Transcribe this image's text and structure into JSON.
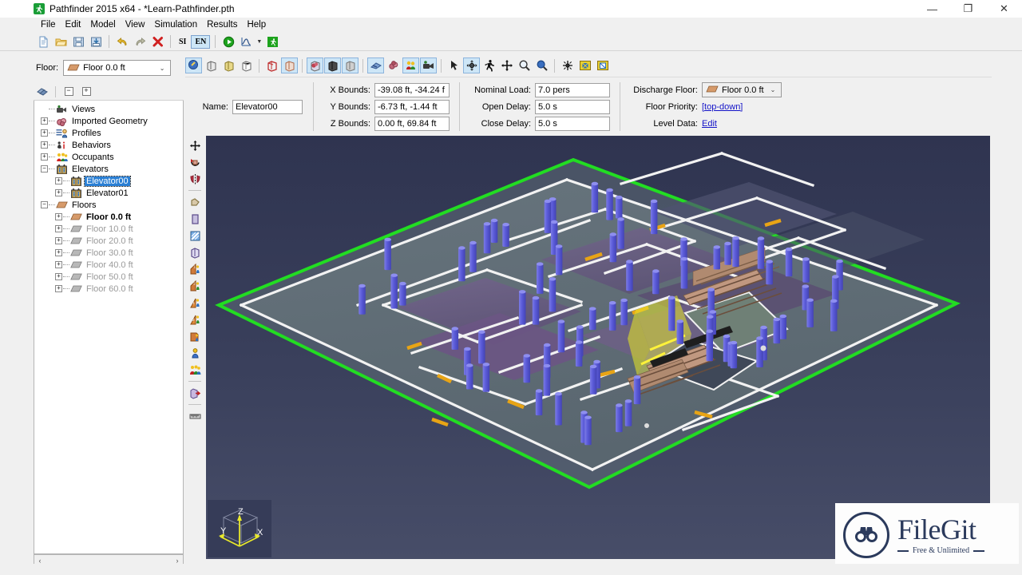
{
  "window": {
    "title": "Pathfinder 2015 x64 - *Learn-Pathfinder.pth",
    "app_icon": "runner-icon",
    "minimize": "—",
    "restore": "❐",
    "close": "✕"
  },
  "menu": {
    "items": [
      {
        "label": "File"
      },
      {
        "label": "Edit"
      },
      {
        "label": "Model"
      },
      {
        "label": "View"
      },
      {
        "label": "Simulation"
      },
      {
        "label": "Results"
      },
      {
        "label": "Help"
      }
    ]
  },
  "toolbar": {
    "items": [
      {
        "name": "new-file-icon",
        "kind": "icon"
      },
      {
        "name": "open-folder-icon",
        "kind": "icon"
      },
      {
        "name": "save-icon",
        "kind": "icon"
      },
      {
        "name": "import-icon",
        "kind": "icon"
      },
      {
        "name": "separator",
        "kind": "sep"
      },
      {
        "name": "undo-icon",
        "kind": "icon"
      },
      {
        "name": "redo-icon",
        "kind": "icon"
      },
      {
        "name": "delete-icon",
        "kind": "icon"
      },
      {
        "name": "separator",
        "kind": "sep"
      },
      {
        "name": "si-units-button",
        "kind": "text",
        "label": "SI",
        "selected": false
      },
      {
        "name": "english-units-button",
        "kind": "text",
        "label": "EN",
        "selected": true
      },
      {
        "name": "separator",
        "kind": "sep"
      },
      {
        "name": "run-simulation-icon",
        "kind": "icon"
      },
      {
        "name": "results-plot-icon",
        "kind": "icon"
      },
      {
        "name": "dropdown-caret-icon",
        "kind": "caret"
      },
      {
        "name": "results-3d-icon",
        "kind": "icon"
      }
    ]
  },
  "floor_selector": {
    "label": "Floor:",
    "value": "Floor 0.0 ft",
    "icon": "floor-icon"
  },
  "tree_toolbar": {
    "navigator_icon": "navigator-icon",
    "collapse_all": "−",
    "expand_all": "+"
  },
  "tree": {
    "nodes": [
      {
        "label": "Views",
        "indent": 0,
        "expander": "none",
        "icon": "views-icon",
        "style": "normal"
      },
      {
        "label": "Imported Geometry",
        "indent": 0,
        "expander": "+",
        "icon": "geometry-icon",
        "style": "normal"
      },
      {
        "label": "Profiles",
        "indent": 0,
        "expander": "+",
        "icon": "profiles-icon",
        "style": "normal"
      },
      {
        "label": "Behaviors",
        "indent": 0,
        "expander": "+",
        "icon": "behaviors-icon",
        "style": "normal"
      },
      {
        "label": "Occupants",
        "indent": 0,
        "expander": "+",
        "icon": "occupants-icon",
        "style": "normal"
      },
      {
        "label": "Elevators",
        "indent": 0,
        "expander": "−",
        "icon": "elevator-icon",
        "style": "normal"
      },
      {
        "label": "Elevator00",
        "indent": 1,
        "expander": "+",
        "icon": "elevator-icon",
        "style": "selected"
      },
      {
        "label": "Elevator01",
        "indent": 1,
        "expander": "+",
        "icon": "elevator-icon",
        "style": "normal"
      },
      {
        "label": "Floors",
        "indent": 0,
        "expander": "−",
        "icon": "floor-icon",
        "style": "normal"
      },
      {
        "label": "Floor 0.0 ft",
        "indent": 1,
        "expander": "+",
        "icon": "floor-icon",
        "style": "bold"
      },
      {
        "label": "Floor 10.0 ft",
        "indent": 1,
        "expander": "+",
        "icon": "floor-gray-icon",
        "style": "dim"
      },
      {
        "label": "Floor 20.0 ft",
        "indent": 1,
        "expander": "+",
        "icon": "floor-gray-icon",
        "style": "dim"
      },
      {
        "label": "Floor 30.0 ft",
        "indent": 1,
        "expander": "+",
        "icon": "floor-gray-icon",
        "style": "dim"
      },
      {
        "label": "Floor 40.0 ft",
        "indent": 1,
        "expander": "+",
        "icon": "floor-gray-icon",
        "style": "dim"
      },
      {
        "label": "Floor 50.0 ft",
        "indent": 1,
        "expander": "+",
        "icon": "floor-gray-icon",
        "style": "dim"
      },
      {
        "label": "Floor 60.0 ft",
        "indent": 1,
        "expander": "+",
        "icon": "floor-gray-icon",
        "style": "dim"
      }
    ],
    "scroll_left": "‹",
    "scroll_right": "›"
  },
  "properties": {
    "name": {
      "label": "Name:",
      "value": "Elevator00"
    },
    "bounds": [
      {
        "label": "X Bounds:",
        "value": "-39.08 ft, -34.24 f"
      },
      {
        "label": "Y Bounds:",
        "value": "-6.73 ft, -1.44 ft"
      },
      {
        "label": "Z Bounds:",
        "value": "0.00 ft, 69.84 ft"
      }
    ],
    "loads": [
      {
        "label": "Nominal Load:",
        "value": "7.0 pers"
      },
      {
        "label": "Open Delay:",
        "value": "5.0 s"
      },
      {
        "label": "Close Delay:",
        "value": "5.0 s"
      }
    ],
    "discharge": {
      "label": "Discharge Floor:",
      "value": "Floor 0.0 ft",
      "icon": "floor-icon"
    },
    "floor_priority": {
      "label": "Floor Priority:",
      "value": "[top-down]"
    },
    "level_data": {
      "label": "Level Data:",
      "value": "Edit"
    }
  },
  "view_toolbar": {
    "items": [
      {
        "name": "select-mode-icon",
        "selected": true
      },
      {
        "name": "show-geometry-icon",
        "selected": false
      },
      {
        "name": "show-solid-icon",
        "selected": false
      },
      {
        "name": "show-wireframe-icon",
        "selected": false
      },
      {
        "name": "sep",
        "kind": "sep"
      },
      {
        "name": "show-edges-icon",
        "selected": false
      },
      {
        "name": "show-faces-icon",
        "selected": true
      },
      {
        "name": "sep",
        "kind": "sep"
      },
      {
        "name": "show-obstructions-icon",
        "selected": true
      },
      {
        "name": "show-navmesh-icon",
        "selected": true
      },
      {
        "name": "show-floor-icon",
        "selected": true
      },
      {
        "name": "sep",
        "kind": "sep"
      },
      {
        "name": "show-paths-icon",
        "selected": true
      },
      {
        "name": "show-geometry-group-icon",
        "selected": false
      },
      {
        "name": "show-occupants-icon",
        "selected": true
      },
      {
        "name": "show-views-icon",
        "selected": true
      },
      {
        "name": "sep",
        "kind": "sep"
      },
      {
        "name": "pointer-tool-icon",
        "selected": false
      },
      {
        "name": "orbit-tool-icon",
        "selected": true
      },
      {
        "name": "walk-tool-icon",
        "selected": false
      },
      {
        "name": "pan-tool-icon",
        "selected": false
      },
      {
        "name": "zoom-tool-icon",
        "selected": false
      },
      {
        "name": "zoom-region-tool-icon",
        "selected": false
      },
      {
        "name": "sep",
        "kind": "sep"
      },
      {
        "name": "reset-view-icon",
        "selected": false
      },
      {
        "name": "fit-to-view-icon",
        "selected": false
      },
      {
        "name": "fit-selection-icon",
        "selected": false
      }
    ]
  },
  "view_left_toolbar": {
    "items": [
      {
        "name": "move-tool-icon"
      },
      {
        "name": "rotate-tool-icon"
      },
      {
        "name": "mirror-tool-icon"
      },
      {
        "name": "sep",
        "kind": "sep"
      },
      {
        "name": "draw-polygon-icon"
      },
      {
        "name": "draw-rectangle-icon"
      },
      {
        "name": "draw-door-icon"
      },
      {
        "name": "draw-obstruction-icon"
      },
      {
        "name": "add-stair-1-icon"
      },
      {
        "name": "add-stair-2-icon"
      },
      {
        "name": "add-ramp-1-icon"
      },
      {
        "name": "add-ramp-2-icon"
      },
      {
        "name": "add-exit-icon"
      },
      {
        "name": "add-occupant-icon"
      },
      {
        "name": "add-occupant-group-icon"
      },
      {
        "name": "sep",
        "kind": "sep"
      },
      {
        "name": "add-source-icon"
      },
      {
        "name": "sep",
        "kind": "sep"
      },
      {
        "name": "measure-tool-icon"
      }
    ]
  },
  "axis_widget": {
    "x": "X",
    "y": "Y",
    "z": "Z"
  },
  "scene": {
    "colors": {
      "background_top": "#2f3450",
      "background_bottom": "#474d68",
      "floor": "#5f6d76",
      "boundary_green": "#22dd22",
      "occupant_blue": "#5a5ad8",
      "wall_white": "#f2f2f2",
      "door_orange": "#e8a415",
      "elevator_yellow": "#e8e82c",
      "stair_brown": "#b08a70",
      "landing_green": "#6f8076",
      "room_purple": "#6e5f87"
    }
  },
  "watermark": {
    "title": "FileGit",
    "subtitle": "Free & Unlimited",
    "logo": "binoculars-icon"
  }
}
